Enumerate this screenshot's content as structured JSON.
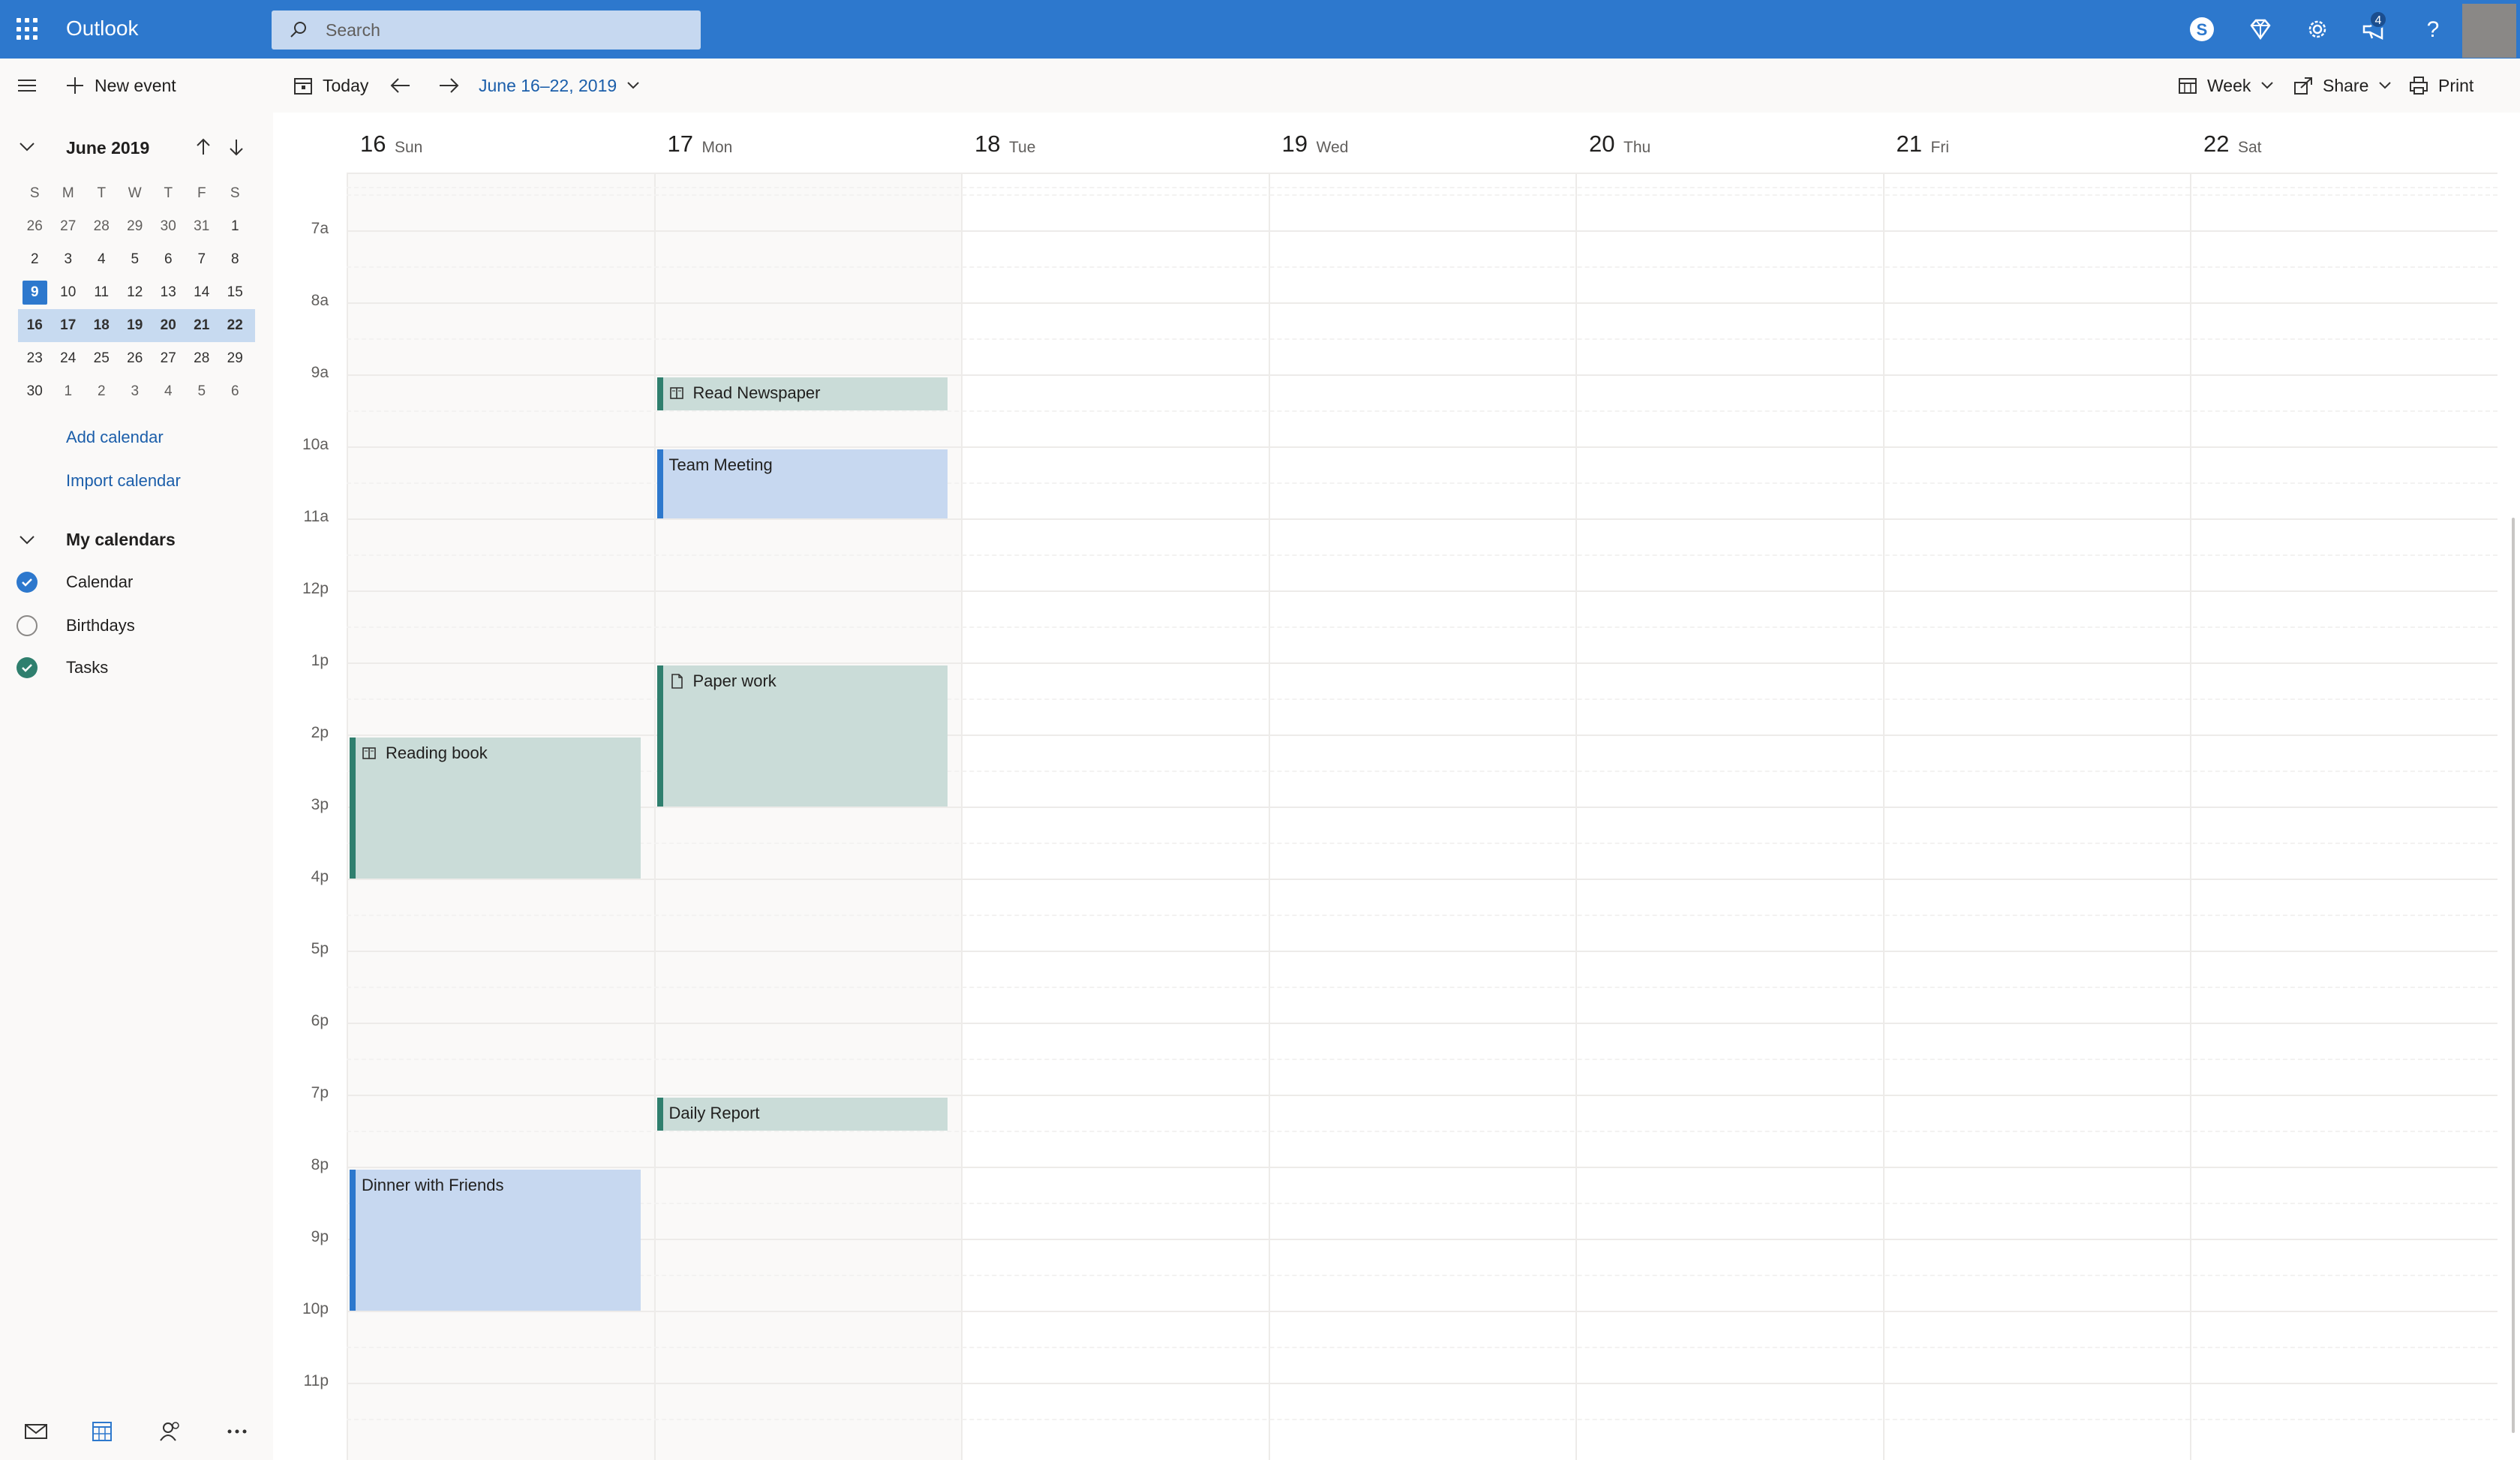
{
  "app": {
    "name": "Outlook",
    "search_placeholder": "Search",
    "notification_count": "4"
  },
  "toolbar": {
    "new_event": "New event",
    "today": "Today",
    "date_range": "June 16–22, 2019",
    "view": "Week",
    "share": "Share",
    "print": "Print"
  },
  "mini_calendar": {
    "title": "June 2019",
    "weekday_headers": [
      "S",
      "M",
      "T",
      "W",
      "T",
      "F",
      "S"
    ],
    "weeks": [
      [
        "26",
        "27",
        "28",
        "29",
        "30",
        "31",
        "1"
      ],
      [
        "2",
        "3",
        "4",
        "5",
        "6",
        "7",
        "8"
      ],
      [
        "9",
        "10",
        "11",
        "12",
        "13",
        "14",
        "15"
      ],
      [
        "16",
        "17",
        "18",
        "19",
        "20",
        "21",
        "22"
      ],
      [
        "23",
        "24",
        "25",
        "26",
        "27",
        "28",
        "29"
      ],
      [
        "30",
        "1",
        "2",
        "3",
        "4",
        "5",
        "6"
      ]
    ],
    "today": "9",
    "selected_week": "16–22"
  },
  "left_pane": {
    "add_calendar": "Add calendar",
    "import_calendar": "Import calendar",
    "my_calendars": "My calendars",
    "calendars": [
      {
        "label": "Calendar",
        "checked": true,
        "color": "#2d78cd"
      },
      {
        "label": "Birthdays",
        "checked": false,
        "color": "#8a8886"
      },
      {
        "label": "Tasks",
        "checked": true,
        "color": "#2f7f6e"
      }
    ]
  },
  "week": {
    "days": [
      {
        "num": "16",
        "name": "Sun"
      },
      {
        "num": "17",
        "name": "Mon"
      },
      {
        "num": "18",
        "name": "Tue"
      },
      {
        "num": "19",
        "name": "Wed"
      },
      {
        "num": "20",
        "name": "Thu"
      },
      {
        "num": "21",
        "name": "Fri"
      },
      {
        "num": "22",
        "name": "Sat"
      }
    ],
    "hours": [
      "7a",
      "8a",
      "9a",
      "10a",
      "11a",
      "12p",
      "1p",
      "2p",
      "3p",
      "4p",
      "5p",
      "6p",
      "7p",
      "8p",
      "9p",
      "10p",
      "11p"
    ]
  },
  "events": [
    {
      "title": "Read Newspaper",
      "day": "17",
      "start": "9:00",
      "end": "9:30",
      "color": "green",
      "icon": "book-icon"
    },
    {
      "title": "Team Meeting",
      "day": "17",
      "start": "10:00",
      "end": "11:00",
      "color": "blue",
      "icon": ""
    },
    {
      "title": "Paper work",
      "day": "17",
      "start": "13:00",
      "end": "15:00",
      "color": "green",
      "icon": "document-icon"
    },
    {
      "title": "Reading book",
      "day": "16",
      "start": "14:00",
      "end": "16:00",
      "color": "green",
      "icon": "book-icon"
    },
    {
      "title": "Daily Report",
      "day": "17",
      "start": "19:00",
      "end": "19:30",
      "color": "green",
      "icon": ""
    },
    {
      "title": "Dinner with Friends",
      "day": "16",
      "start": "20:00",
      "end": "22:00",
      "color": "blue",
      "icon": ""
    }
  ],
  "colors": {
    "brand": "#2d78cd",
    "event_green": "#cadcd8",
    "event_blue": "#c7d8f0"
  }
}
